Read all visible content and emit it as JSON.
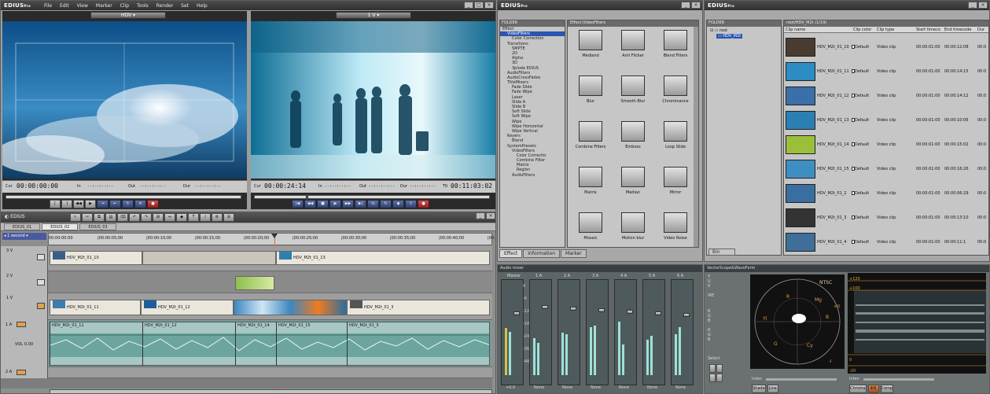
{
  "main_window": {
    "brand": "EDIUS",
    "brand_suffix": "Pro",
    "menu": [
      "File",
      "Edit",
      "View",
      "Marker",
      "Clip",
      "Tools",
      "Render",
      "Set",
      "Help"
    ]
  },
  "player": {
    "format": "HDV",
    "tc_in_label": "Cur",
    "tc_value": "00:00:00:00",
    "in_label": "In",
    "in_value": "--:--:--:--",
    "out_label": "Out",
    "out_value": "--:--:--:--",
    "dur_label": "Dur",
    "dur_value": "--:--:--:--"
  },
  "recorder": {
    "format": "1 V",
    "tc_label": "Cur",
    "tc_value": "00:00:24:14",
    "in_label": "In",
    "in_value": "--:--:--:--",
    "out_label": "Out",
    "out_value": "--:--:--:--",
    "dur_label": "Dur",
    "dur_value": "--:--:--:--",
    "ttl_label": "Ttl",
    "ttl_value": "00:11:03:02"
  },
  "timeline": {
    "title": "EDIUS",
    "sequences": [
      "EDIUS_01",
      "EDIUS_02",
      "EDIUS_03"
    ],
    "zoom": "1 second",
    "ruler": [
      "00:00:00:00",
      "|00:00:05;00",
      "|00:00:10;00",
      "|00:00:15;00",
      "|00:00:20;00",
      "|00:00:25;00",
      "|00:00:30;00",
      "|00:00:35;00",
      "|00:00:40;00",
      "|00:00:45;00"
    ],
    "tracks": [
      {
        "name": "3 V",
        "clips": [
          {
            "label": "HDV_M2t_01_10"
          },
          {
            "label": "HDV_M2t_01_13"
          }
        ]
      },
      {
        "name": "2 V",
        "clips": []
      },
      {
        "name": "1 V",
        "clips": [
          {
            "label": "HDV_M2t_01_11"
          },
          {
            "label": "HDV_M2t_01_12"
          },
          {
            "label": "HDV_M2t_01_3"
          }
        ]
      },
      {
        "name": "1 A",
        "clips": [
          {
            "label": "HDV_M2t_01_11"
          },
          {
            "label": "HDV_M2t_01_12"
          },
          {
            "label": "HDV_M2t_01_14"
          },
          {
            "label": "HDV_M2t_01_15"
          },
          {
            "label": "HDV_M2t_01_3"
          }
        ]
      },
      {
        "name": "2 A",
        "clips": []
      }
    ],
    "vol_label": "VOL",
    "vol_value": "0.00"
  },
  "effect_window": {
    "brand": "EDIUS",
    "brand_suffix": "Pro",
    "folder_header": "FOLDER",
    "list_header": "Effect:VideoFilters",
    "tree": [
      "Effect",
      "VideoFilters",
      "Color Correction",
      "Transitions",
      "SMPTE",
      "2D",
      "Alpha",
      "3D",
      "3plode EDIUS",
      "AudioFilters",
      "AudioCrossFades",
      "TitleMixers",
      "Fade Slide",
      "Fade Wipe",
      "Laser",
      "Slide A",
      "Slide B",
      "Soft Slide",
      "Soft Wipe",
      "Wipe",
      "Wipe Horizontal",
      "Wipe Vertical",
      "Keyers",
      "Blend",
      "SystemPresets",
      "VideoFilters",
      "Color Correctio",
      "Combine Filter",
      "Matrix",
      "Region",
      "AudioFilters"
    ],
    "effects": [
      "Mediand",
      "Anti Flicker",
      "Blend Filters",
      "Blur",
      "Smooth Blur",
      "Chrominance",
      "Combine Filters",
      "Emboss",
      "Loop Slide",
      "Matrix",
      "Median",
      "Mirror",
      "Mosaic",
      "Motion blur",
      "Video Noise"
    ],
    "tabs": [
      "Effect",
      "Information",
      "Marker"
    ]
  },
  "bin_window": {
    "brand": "EDIUS",
    "brand_suffix": "Pro",
    "folder_header": "FOLDER",
    "path": "root/HDV_M2t (1/19)",
    "tree": [
      "root",
      "HDV_M2t"
    ],
    "columns": [
      "Clip name",
      "Clip color",
      "Clip type",
      "Start timeco",
      "End timecode",
      "Dur"
    ],
    "rows": [
      {
        "name": "HDV_M2t_01_10",
        "color": "Default",
        "type": "Video clip",
        "start": "00:00:01:00",
        "end": "00:00:12:08",
        "dur": "00:0"
      },
      {
        "name": "HDV_M2t_01_11",
        "color": "Default",
        "type": "Video clip",
        "start": "00:00:01:00",
        "end": "00:00:14:15",
        "dur": "00:0"
      },
      {
        "name": "HDV_M2t_01_12",
        "color": "Default",
        "type": "Video clip",
        "start": "00:00:01:00",
        "end": "00:00:14:12",
        "dur": "00:0"
      },
      {
        "name": "HDV_M2t_01_13",
        "color": "Default",
        "type": "Video clip",
        "start": "00:00:01:00",
        "end": "00:00:10:06",
        "dur": "00:0"
      },
      {
        "name": "HDV_M2t_01_14",
        "color": "Default",
        "type": "Video clip",
        "start": "00:00:01:00",
        "end": "00:00:15:02",
        "dur": "00:0"
      },
      {
        "name": "HDV_M2t_01_15",
        "color": "Default",
        "type": "Video clip",
        "start": "00:00:01:00",
        "end": "00:00:16:26",
        "dur": "00:0"
      },
      {
        "name": "HDV_M2t_01_2",
        "color": "Default",
        "type": "Video clip",
        "start": "00:00:01:00",
        "end": "00:00:06:29",
        "dur": "00:0"
      },
      {
        "name": "HDV_M2t_01_3",
        "color": "Default",
        "type": "Video clip",
        "start": "00:00:01:00",
        "end": "00:00:13:10",
        "dur": "00:0"
      },
      {
        "name": "HDV_M2t_01_4",
        "color": "Default",
        "type": "Video clip",
        "start": "00:00:01:00",
        "end": "00:00:11:1",
        "dur": "00:0"
      }
    ],
    "tab": "Bin"
  },
  "audio_mixer": {
    "title": "Audio mixer",
    "channels": [
      "Master",
      "1 A",
      "2 A",
      "3 A",
      "4 A",
      "5 A",
      "6 A"
    ],
    "master_value": "+0.0",
    "channel_value": "None",
    "scale": [
      "0",
      "-6",
      "-12",
      "-18",
      "-24",
      "-36",
      "-48"
    ]
  },
  "scope": {
    "title": "VectorScope&WaveForm",
    "std": "NTSC",
    "labels": [
      "Y",
      "U",
      "V",
      "R",
      "G",
      "B",
      "R",
      "G",
      "B",
      "Select"
    ],
    "ire_label": "IRE",
    "vec_marks": [
      "R",
      "Mg",
      "B",
      "Cy",
      "G",
      "Yl",
      "+Q",
      "-I"
    ],
    "wave_marks": [
      "+120",
      "+100",
      "0",
      "-20"
    ],
    "inten_label": "Inten",
    "buttons": [
      "Shade",
      "Line",
      "Chroma",
      "IRE",
      "Comp"
    ]
  }
}
